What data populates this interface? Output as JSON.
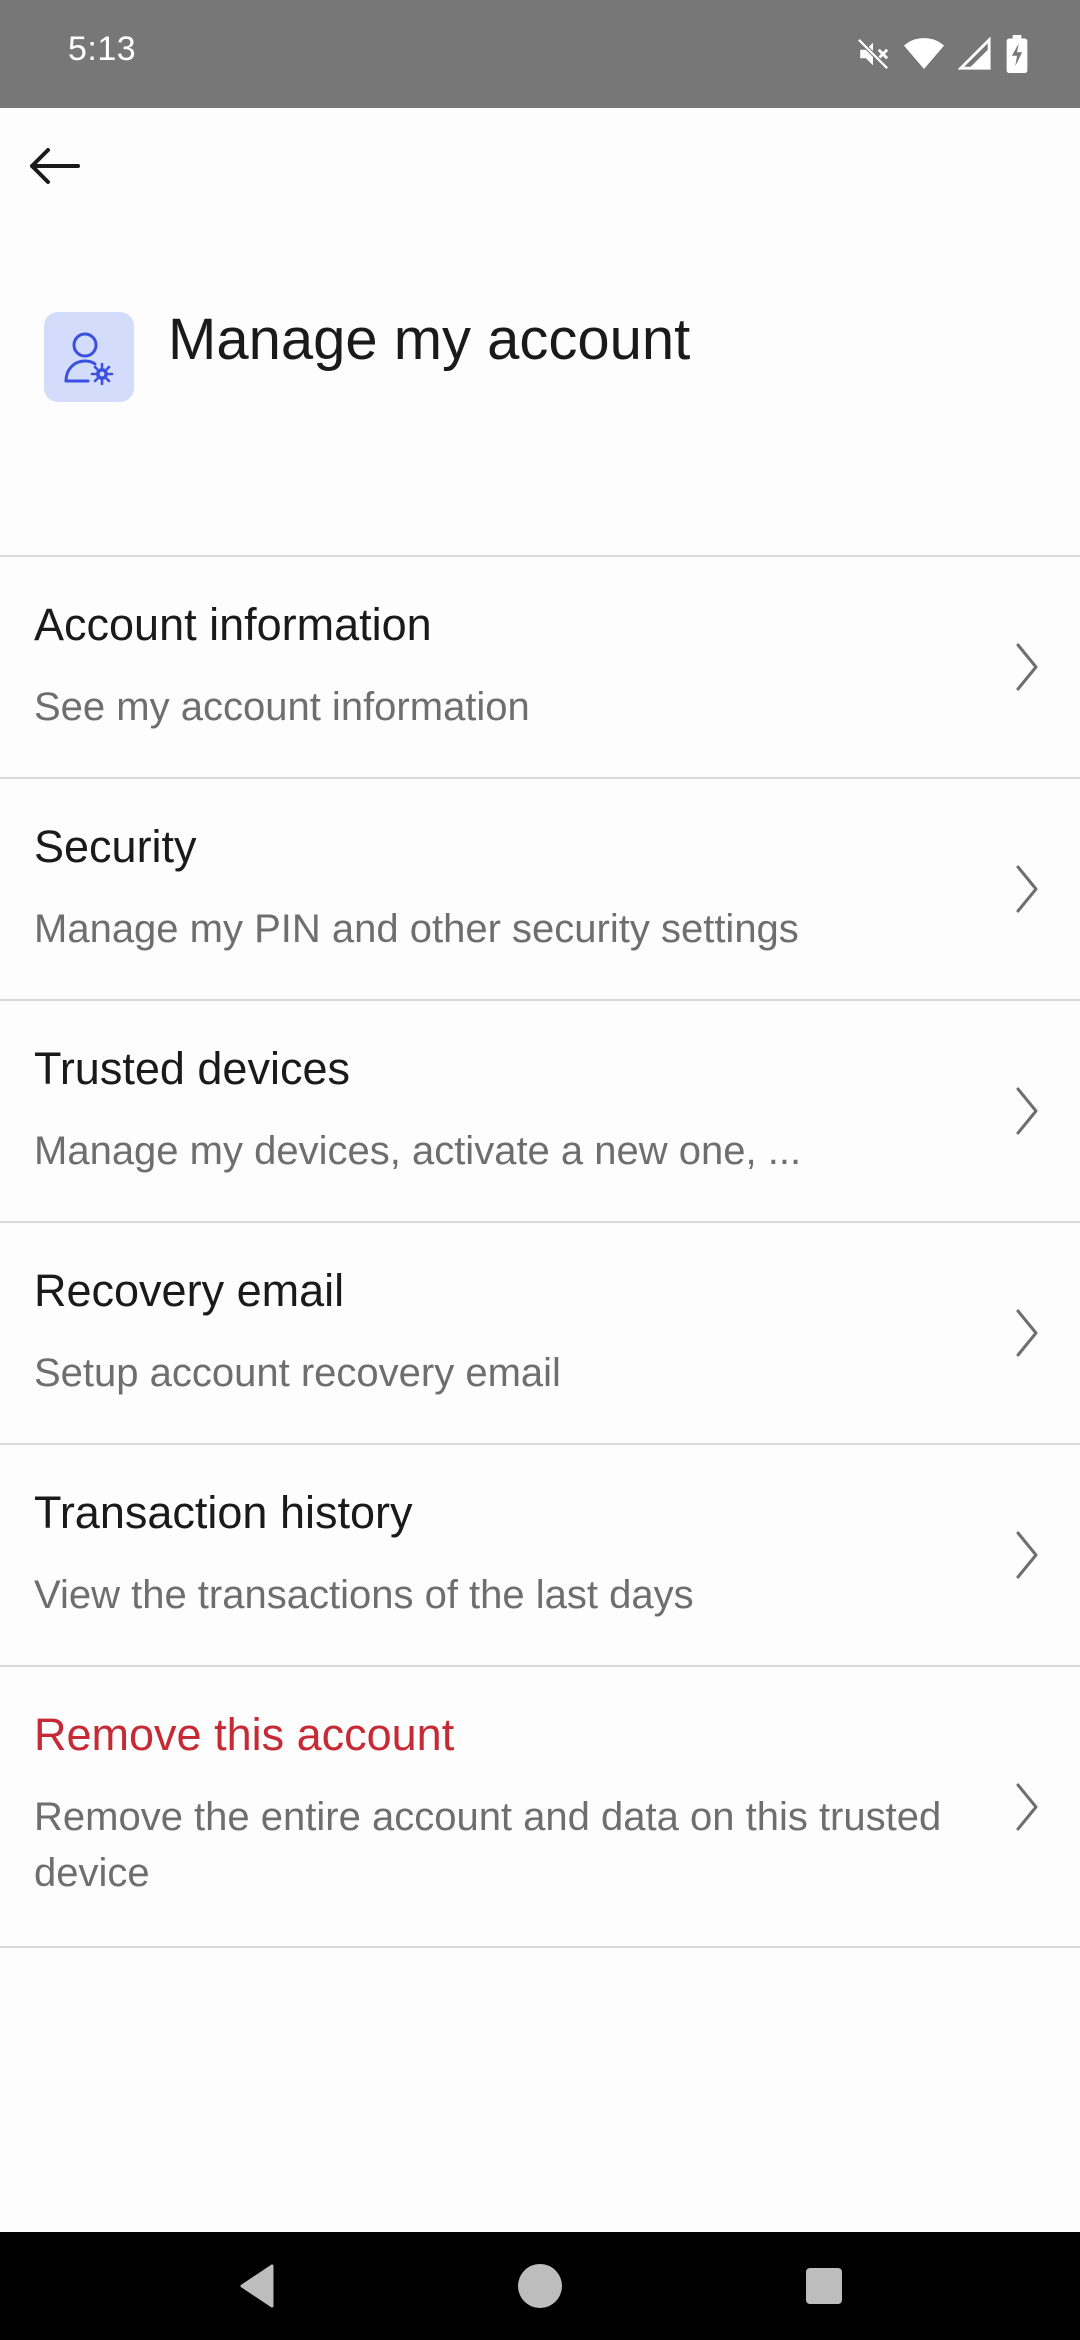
{
  "status_bar": {
    "time": "5:13",
    "icons": [
      "mute-icon",
      "wifi-icon",
      "signal-icon",
      "battery-charging-icon"
    ]
  },
  "app_bar": {
    "back_icon": "arrow-left-icon"
  },
  "header": {
    "icon": "user-settings-icon",
    "title": "Manage my account"
  },
  "menu": {
    "items": [
      {
        "title": "Account information",
        "subtitle": "See my account information"
      },
      {
        "title": "Security",
        "subtitle": "Manage my PIN and other security settings"
      },
      {
        "title": "Trusted devices",
        "subtitle": "Manage my devices, activate a new one, ..."
      },
      {
        "title": "Recovery email",
        "subtitle": "Setup account recovery email"
      },
      {
        "title": "Transaction history",
        "subtitle": "View the transactions of the last days"
      },
      {
        "title": "Remove this account",
        "subtitle": "Remove the entire account and data on this trusted device"
      }
    ]
  },
  "colors": {
    "status_bar": "#777777",
    "icon_tile": "#d3dcfb",
    "icon_stroke": "#3b50e0",
    "danger": "#c62a34",
    "divider": "#d8d8d8"
  },
  "nav_bar": {
    "icons": [
      "back-triangle-icon",
      "home-circle-icon",
      "recents-square-icon"
    ]
  }
}
